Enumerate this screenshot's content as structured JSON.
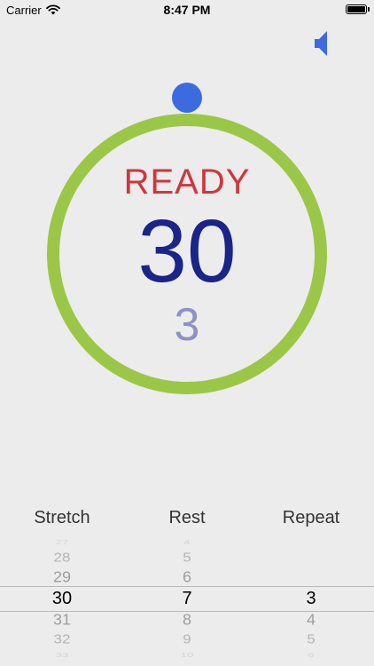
{
  "status_bar": {
    "carrier": "Carrier",
    "time": "8:47 PM",
    "wifi_icon": "wifi-icon",
    "battery_icon": "battery-icon"
  },
  "colors": {
    "background": "#ececec",
    "ring": "#9bc748",
    "knob": "#3c6be0",
    "speaker": "#3c6be0",
    "ready_text": "#d1353d",
    "count_text": "#1b2488",
    "round_text": "#8e91c6"
  },
  "sound_button": {
    "icon": "speaker-icon"
  },
  "timer": {
    "status": "READY",
    "count": "30",
    "round": "3"
  },
  "picker": {
    "headers": {
      "stretch": "Stretch",
      "rest": "Rest",
      "repeat": "Repeat"
    },
    "stretch": {
      "values": [
        "27",
        "28",
        "29",
        "30",
        "31",
        "32",
        "33"
      ],
      "selected": "30"
    },
    "rest": {
      "values": [
        "4",
        "5",
        "6",
        "7",
        "8",
        "9",
        "10"
      ],
      "selected": "7"
    },
    "repeat": {
      "values": [
        "",
        "",
        "",
        "3",
        "4",
        "5",
        "6"
      ],
      "selected": "3"
    }
  }
}
